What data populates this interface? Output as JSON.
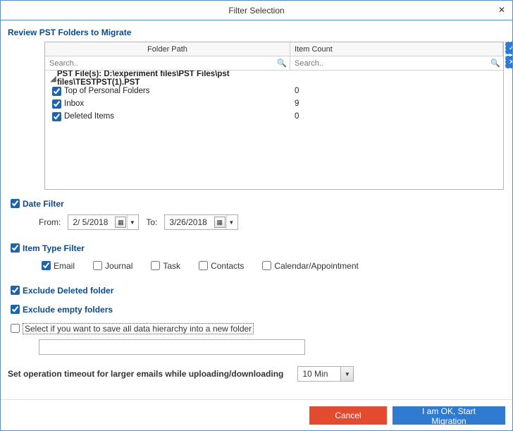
{
  "window": {
    "title": "Filter Selection"
  },
  "review": {
    "title": "Review PST Folders to Migrate",
    "columns": {
      "path": "Folder Path",
      "count": "Item Count"
    },
    "search_placeholder": "Search..",
    "root_label": "PST File(s): D:\\experiment files\\PST Files\\pst files\\TESTPST(1).PST",
    "folders": [
      {
        "name": "Top of Personal Folders",
        "count": "0",
        "checked": true
      },
      {
        "name": "Inbox",
        "count": "9",
        "checked": true
      },
      {
        "name": "Deleted Items",
        "count": "0",
        "checked": true
      }
    ]
  },
  "date_filter": {
    "label": "Date Filter",
    "checked": true,
    "from_label": "From:",
    "from_value": "2/ 5/2018",
    "to_label": "To:",
    "to_value": "3/26/2018"
  },
  "item_filter": {
    "label": "Item Type Filter",
    "checked": true,
    "types": [
      {
        "label": "Email",
        "checked": true
      },
      {
        "label": "Journal",
        "checked": false
      },
      {
        "label": "Task",
        "checked": false
      },
      {
        "label": "Contacts",
        "checked": false
      },
      {
        "label": "Calendar/Appointment",
        "checked": false
      }
    ]
  },
  "exclude_deleted": {
    "label": "Exclude Deleted folder",
    "checked": true
  },
  "exclude_empty": {
    "label": "Exclude empty folders",
    "checked": true
  },
  "save_hierarchy": {
    "label": "Select if you want to save all data hierarchy into a new folder",
    "checked": false,
    "value": ""
  },
  "timeout": {
    "label": "Set operation timeout for larger emails while uploading/downloading",
    "value": "10 Min"
  },
  "buttons": {
    "cancel": "Cancel",
    "ok": "I am OK, Start Migration"
  },
  "side": {
    "check_all": "✓",
    "uncheck_all": "✕"
  }
}
